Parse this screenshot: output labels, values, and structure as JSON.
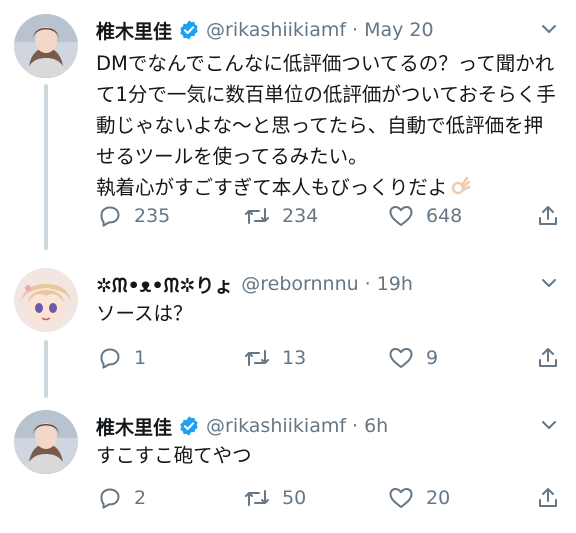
{
  "tweets": [
    {
      "name": "椎木里佳",
      "handle": "@rikashiikiamf",
      "separator": "·",
      "time": "May 20",
      "text": "DMでなんでこんなに低評価ついてるの？って聞かれて1分で一気に数百単位の低評価がついておそらく手動じゃないよな〜と思ってたら、自動で低評価を押せるツールを使ってるみたい。\n執着心がすごすぎて本人もびっくりだよ",
      "replies": "235",
      "retweets": "234",
      "likes": "648",
      "verified": true
    },
    {
      "name": "✲ᙏ•ᴥ•ᙏ✲りょ",
      "handle": "@rebornnnu",
      "separator": "·",
      "time": "19h",
      "text": "ソースは？",
      "replies": "1",
      "retweets": "13",
      "likes": "9",
      "verified": false
    },
    {
      "name": "椎木里佳",
      "handle": "@rikashiikiamf",
      "separator": "·",
      "time": "6h",
      "text": "すこすこ砲てやつ",
      "replies": "2",
      "retweets": "50",
      "likes": "20",
      "verified": true
    }
  ],
  "colors": {
    "verified": "#1da1f2",
    "muted": "#657786",
    "thread_line": "#ccd6dd",
    "text": "#14171a"
  }
}
